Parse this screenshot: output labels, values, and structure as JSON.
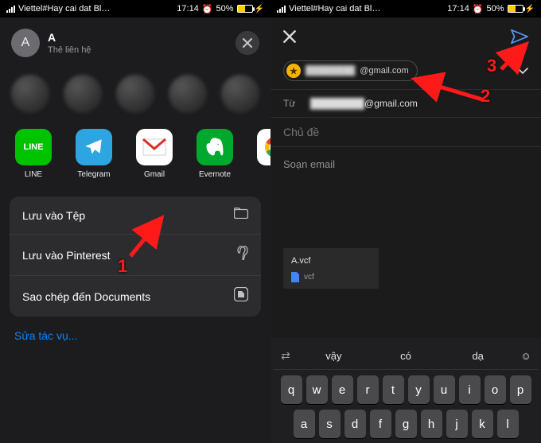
{
  "status": {
    "carrier_text": "Viettel#Hay cai dat Bl…",
    "time": "17:14",
    "battery_pct": "50%"
  },
  "share": {
    "contact_initial": "A",
    "contact_name": "A",
    "contact_subtitle": "Thẻ liên hệ",
    "apps": [
      {
        "name": "LINE"
      },
      {
        "name": "Telegram"
      },
      {
        "name": "Gmail"
      },
      {
        "name": "Evernote"
      },
      {
        "name": "Go"
      }
    ],
    "actions": {
      "files": "Lưu vào Tệp",
      "pinterest": "Lưu vào Pinterest",
      "documents": "Sao chép đến Documents"
    },
    "more": "Sửa tác vụ..."
  },
  "compose": {
    "to_chip_suffix": "@gmail.com",
    "from_label": "Từ",
    "from_suffix": "@gmail.com",
    "subject_placeholder": "Chủ đề",
    "body_placeholder": "Soạn email",
    "attachment_name": "A.vcf",
    "attachment_type": "vcf"
  },
  "keyboard": {
    "suggestions": [
      "vậy",
      "có",
      "dạ"
    ],
    "row1": [
      "q",
      "w",
      "e",
      "r",
      "t",
      "y",
      "u",
      "i",
      "o",
      "p"
    ],
    "row2": [
      "a",
      "s",
      "d",
      "f",
      "g",
      "h",
      "j",
      "k",
      "l"
    ]
  },
  "annotations": {
    "n1": "1",
    "n2": "2",
    "n3": "3"
  }
}
